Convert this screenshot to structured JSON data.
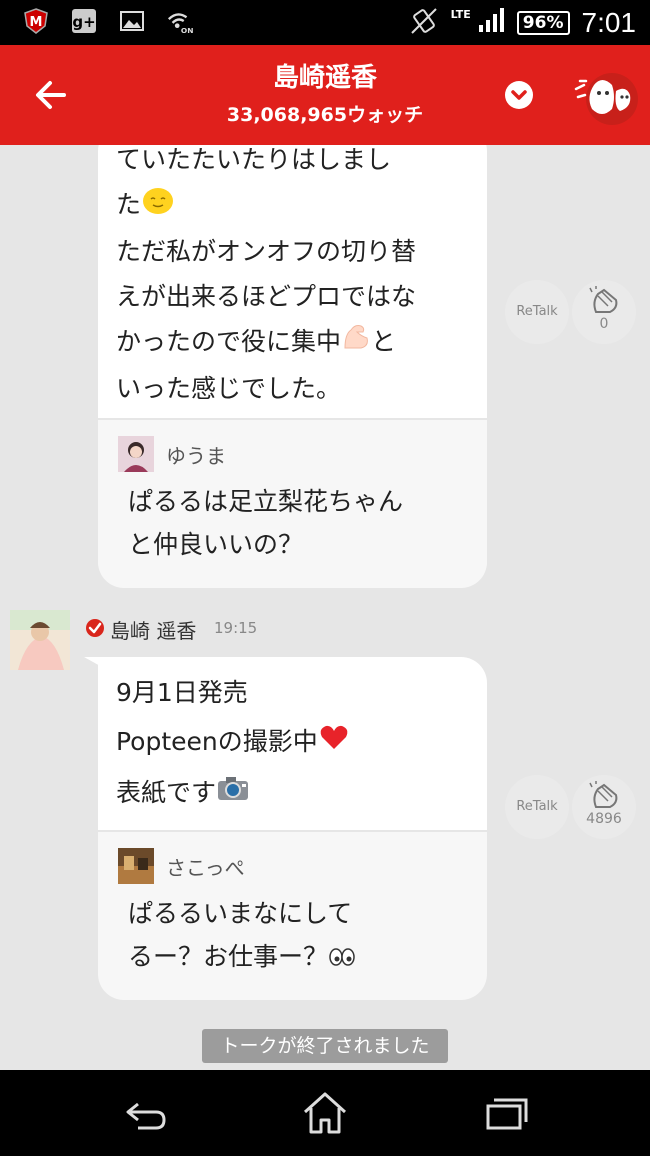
{
  "status_bar": {
    "network": "LTE",
    "battery": "96%",
    "time": "7:01",
    "icons": [
      "mcafee-icon",
      "google-plus-icon",
      "image-icon",
      "wifi-on-icon"
    ]
  },
  "header": {
    "title": "島崎遥香",
    "subtitle": "33,068,965ウォッチ"
  },
  "messages": [
    {
      "lines": [
        "ていたたいたりはしまし",
        "た",
        "ただ私がオンオフの切り替",
        "えが出来るほどプロではな",
        "かったので役に集中",
        "いった感じでした。"
      ],
      "line_suffix_4": "と",
      "reply": {
        "user": "ゆうま",
        "lines": [
          "ぱるるは足立梨花ちゃん",
          "と仲良いいの？"
        ]
      },
      "retalk_label": "ReTalk",
      "clap_count": "0"
    },
    {
      "sender": "島崎 遥香",
      "time": "19:15",
      "lines": [
        "9月1日発売",
        "Popteenの撮影中",
        "表紙です"
      ],
      "reply": {
        "user": "さこっぺ",
        "lines": [
          "ぱるるいまなにして",
          "るー？お仕事ー？"
        ]
      },
      "retalk_label": "ReTalk",
      "clap_count": "4896"
    }
  ],
  "ended_notice": "トークが終了されました",
  "colors": {
    "header": "#e0201c",
    "background": "#e6e6e6",
    "verified": "#d9261c"
  }
}
